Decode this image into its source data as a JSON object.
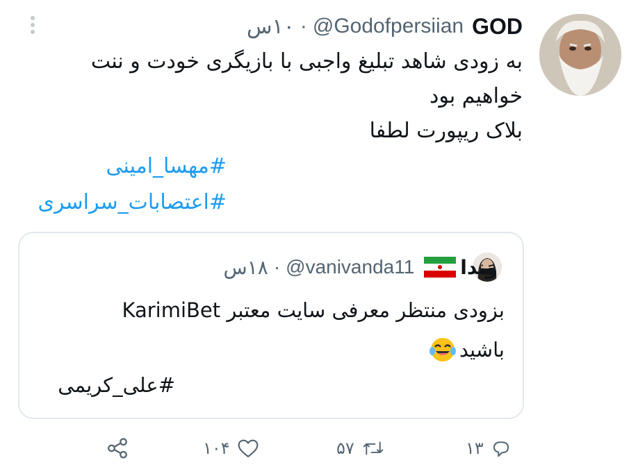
{
  "tweet": {
    "author_name": "GOD",
    "author_handle": "@Godofpersiian",
    "separator": "·",
    "time": "۱۰س",
    "lines": [
      "به زودی شاهد تبلیغ واجبی با بازیگری خودت و ننت",
      "خواهیم بود",
      "بلاک ریپورت لطفا"
    ],
    "hashtags": [
      "#مهسا_امینی",
      "#اعتصابات_سراسری"
    ],
    "colors": {
      "link": "#1d9bf0",
      "secondary_text": "#536471",
      "border": "#e1e8ed"
    }
  },
  "quoted": {
    "author_name": "وَندا",
    "flag_icon": "iran-flag-icon",
    "author_handle": "@vanivanda11",
    "separator": "·",
    "time": "۱۸س",
    "line1": "بزودی منتظر معرفی سایت معتبر  KarimiBet",
    "line2": "باشید",
    "emoji_icon": "tears-of-joy-emoji-icon",
    "hashtag": "#علی_کریمی"
  },
  "actions": {
    "reply_count": "۱۳",
    "retweet_count": "۵۷",
    "like_count": "۱۰۴"
  }
}
